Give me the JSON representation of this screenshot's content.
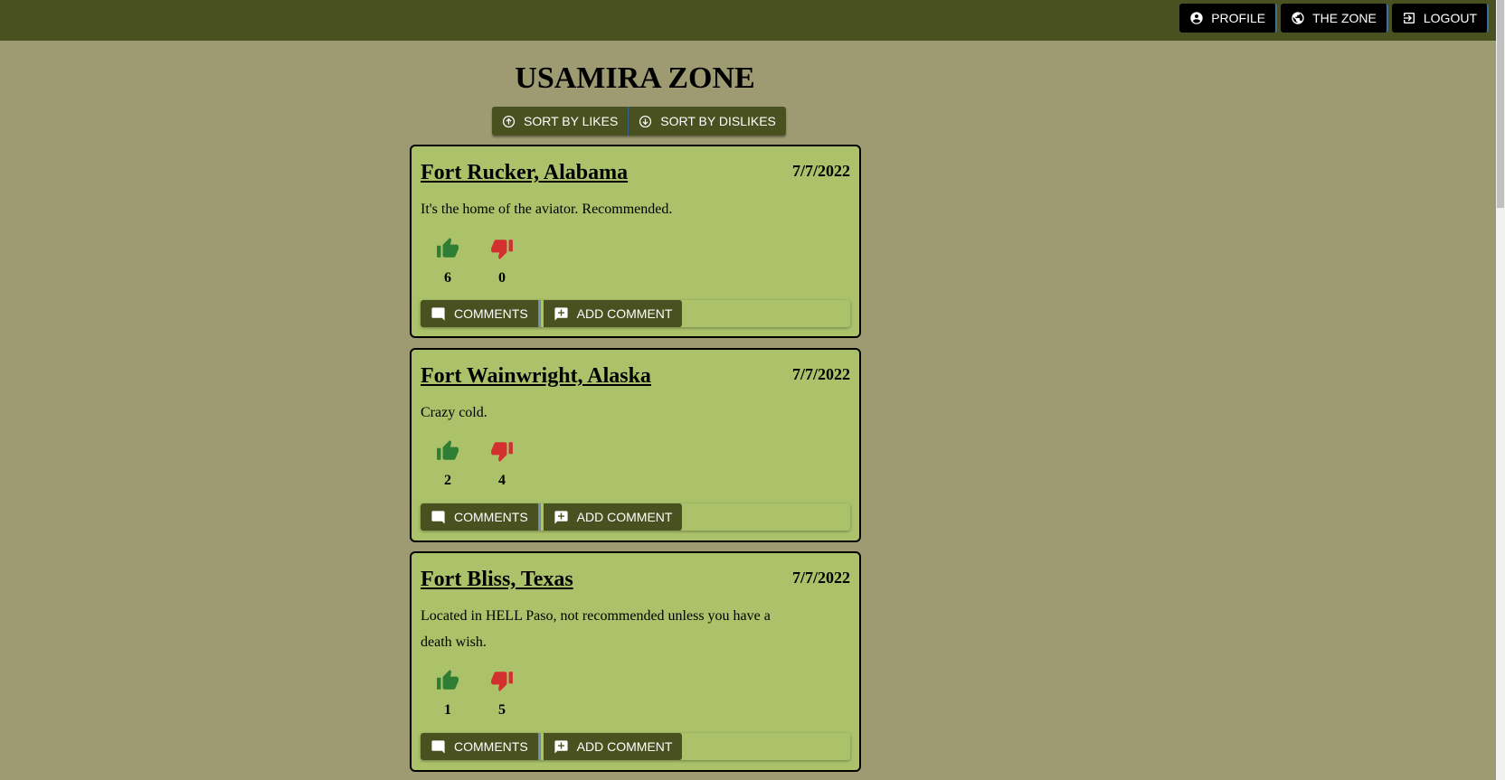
{
  "nav": {
    "profile": "PROFILE",
    "zone": "THE ZONE",
    "logout": "LOGOUT"
  },
  "page": {
    "title": "USAMIRA ZONE",
    "sort_likes": "SORT BY LIKES",
    "sort_dislikes": "SORT BY DISLIKES"
  },
  "posts": [
    {
      "title": "Fort Rucker, Alabama",
      "date": "7/7/2022",
      "body": "It's the home of the aviator. Recommended.",
      "likes": "6",
      "dislikes": "0",
      "comments_label": "COMMENTS",
      "add_comment_label": "ADD COMMENT"
    },
    {
      "title": "Fort Wainwright, Alaska",
      "date": "7/7/2022",
      "body": "Crazy cold.",
      "likes": "2",
      "dislikes": "4",
      "comments_label": "COMMENTS",
      "add_comment_label": "ADD COMMENT"
    },
    {
      "title": "Fort Bliss, Texas",
      "date": "7/7/2022",
      "body": "Located in HELL Paso, not recommended unless you have a death wish.",
      "likes": "1",
      "dislikes": "5",
      "comments_label": "COMMENTS",
      "add_comment_label": "ADD COMMENT"
    }
  ],
  "colors": {
    "background": "#9e9b73",
    "header": "#4a5120",
    "card": "#abc26b",
    "like": "#2e7d32",
    "dislike": "#d32f2f"
  }
}
